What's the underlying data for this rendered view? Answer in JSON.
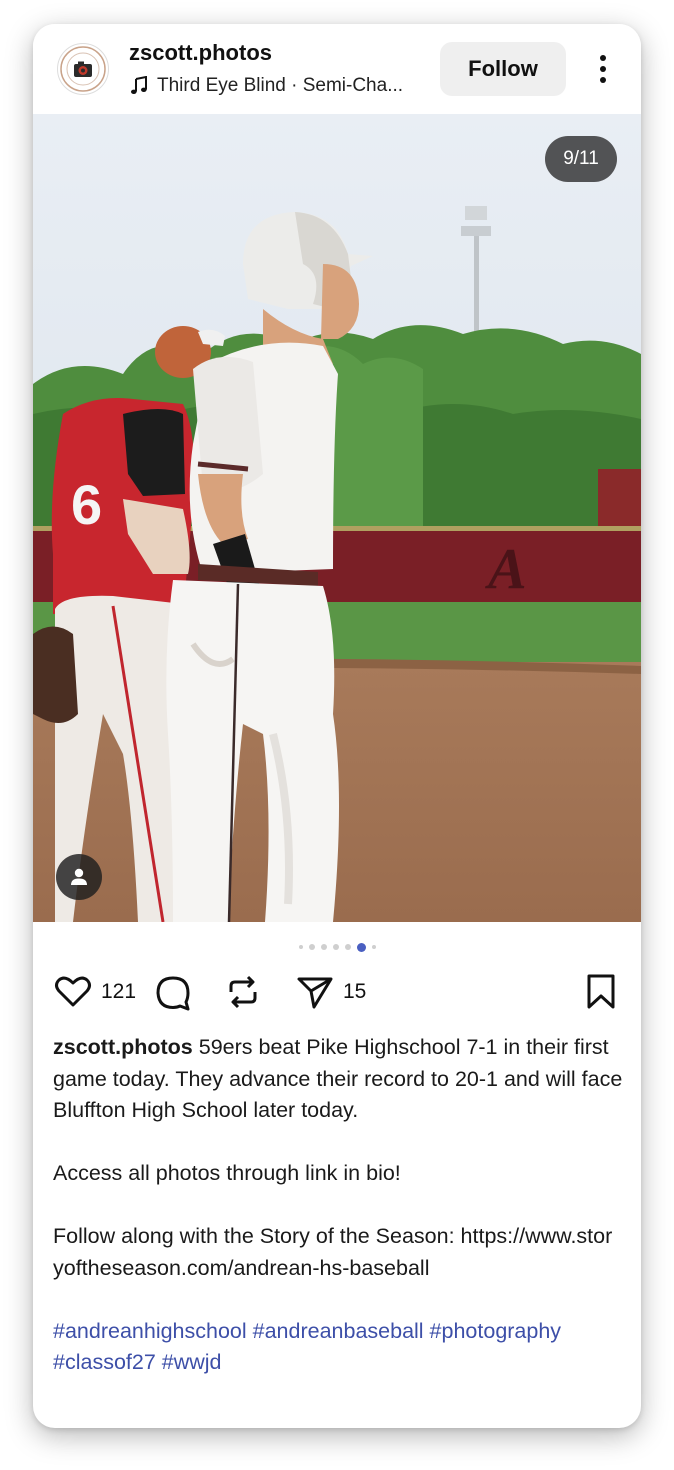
{
  "post": {
    "username": "zscott.photos",
    "avatar_text": "ZANE SCOTT",
    "music": "Third Eye Blind · Semi-Cha...",
    "follow_label": "Follow",
    "image_counter": "9/11",
    "likes": "121",
    "shares": "15",
    "caption": {
      "username": "zscott.photos",
      "line1": "59ers beat Pike Highschool 7-1 in their first game today. They advance their record to 20-1 and will face Bluffton High School later today.",
      "line2": "Access all photos through link in bio!",
      "line3": "Follow along with the Story of the Season: https://www.storyoftheseason.com/andrean-hs-baseball",
      "hashtags": "#andreanhighschool #andreanbaseball #photography #classof27 #wwjd"
    },
    "carousel": {
      "total_dots": 7,
      "active_index": 5
    }
  },
  "photo": {
    "description_text": {
      "jersey_number": "6",
      "fence_logo": "A"
    }
  },
  "colors": {
    "accent_link": "#3d4fa8",
    "active_dot": "#4a5fc1",
    "follow_bg": "#efefef"
  },
  "icons": {
    "music": "music-note-icon",
    "more": "more-vertical-icon",
    "like": "heart-icon",
    "comment": "comment-icon",
    "repost": "repost-icon",
    "share": "send-icon",
    "save": "bookmark-icon",
    "tag": "person-tag-icon"
  }
}
